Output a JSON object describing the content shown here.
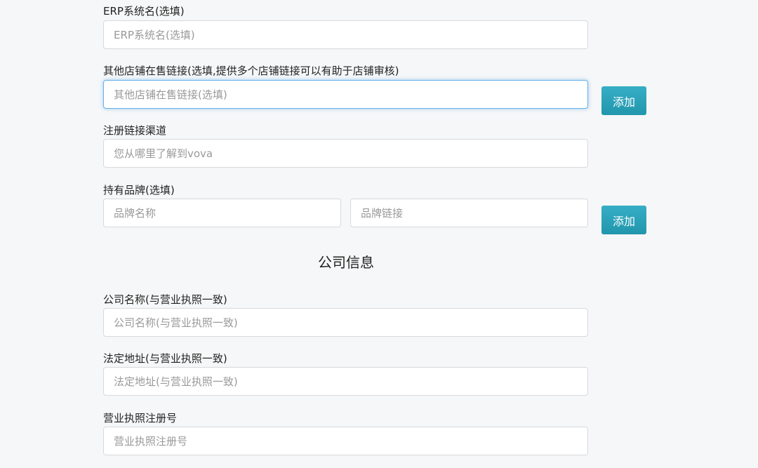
{
  "erp_field": {
    "label": "ERP系统名(选填)",
    "placeholder": "ERP系统名(选填)"
  },
  "other_store_field": {
    "label": "其他店铺在售链接(选填,提供多个店铺链接可以有助于店铺审核)",
    "placeholder": "其他店铺在售链接(选填)",
    "add_label": "添加"
  },
  "channel_field": {
    "label": "注册链接渠道",
    "placeholder": "您从哪里了解到vova"
  },
  "brand_field": {
    "label": "持有品牌(选填)",
    "name_placeholder": "品牌名称",
    "link_placeholder": "品牌链接",
    "add_label": "添加"
  },
  "company_section": {
    "title": "公司信息"
  },
  "company_name_field": {
    "label": "公司名称(与营业执照一致)",
    "placeholder": "公司名称(与营业执照一致)"
  },
  "legal_address_field": {
    "label": "法定地址(与营业执照一致)",
    "placeholder": "法定地址(与营业执照一致)"
  },
  "license_number_field": {
    "label": "营业执照注册号",
    "placeholder": "营业执照注册号"
  },
  "colors": {
    "accent": "#2aa3ba",
    "focus_border": "#66afe9",
    "background": "#f6f7f8"
  }
}
